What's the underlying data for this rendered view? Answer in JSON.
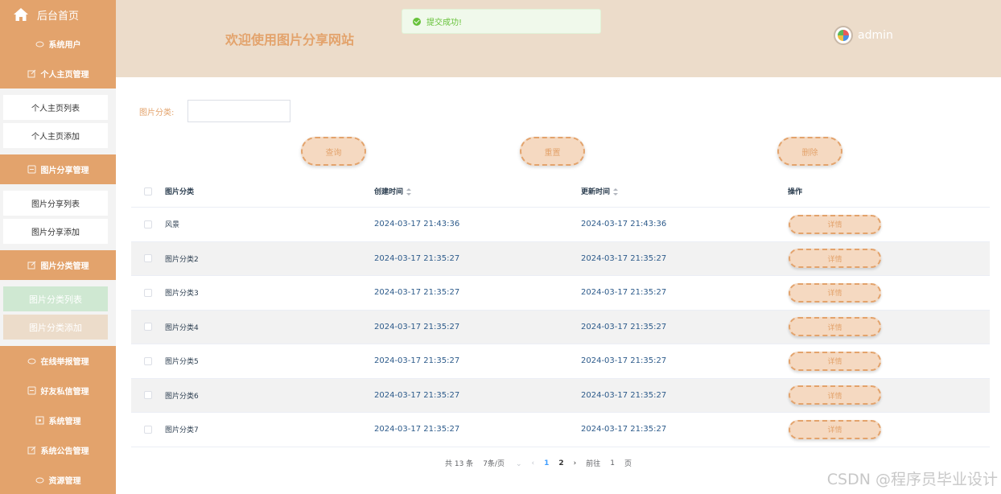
{
  "sidebar": {
    "home": "后台首页",
    "groups": [
      {
        "label": "系统用户"
      },
      {
        "label": "个人主页管理",
        "items": [
          "个人主页列表",
          "个人主页添加"
        ]
      },
      {
        "label": "图片分享管理",
        "items": [
          "图片分享列表",
          "图片分享添加"
        ]
      },
      {
        "label": "图片分类管理",
        "items": [
          "图片分类列表",
          "图片分类添加"
        ]
      },
      {
        "label": "在线举报管理"
      },
      {
        "label": "好友私信管理"
      },
      {
        "label": "系统管理"
      },
      {
        "label": "系统公告管理"
      },
      {
        "label": "资源管理"
      }
    ]
  },
  "header": {
    "title": "欢迎使用图片分享网站",
    "user": "admin"
  },
  "toast": {
    "message": "提交成功!"
  },
  "filter": {
    "label": "图片分类:",
    "value": ""
  },
  "buttons": {
    "search": "查询",
    "reset": "重置",
    "delete": "删除"
  },
  "table": {
    "columns": [
      "图片分类",
      "创建时间",
      "更新时间",
      "操作"
    ],
    "detail_label": "详情",
    "rows": [
      {
        "category": "风景",
        "created": "2024-03-17 21:43:36",
        "updated": "2024-03-17 21:43:36"
      },
      {
        "category": "图片分类2",
        "created": "2024-03-17 21:35:27",
        "updated": "2024-03-17 21:35:27"
      },
      {
        "category": "图片分类3",
        "created": "2024-03-17 21:35:27",
        "updated": "2024-03-17 21:35:27"
      },
      {
        "category": "图片分类4",
        "created": "2024-03-17 21:35:27",
        "updated": "2024-03-17 21:35:27"
      },
      {
        "category": "图片分类5",
        "created": "2024-03-17 21:35:27",
        "updated": "2024-03-17 21:35:27"
      },
      {
        "category": "图片分类6",
        "created": "2024-03-17 21:35:27",
        "updated": "2024-03-17 21:35:27"
      },
      {
        "category": "图片分类7",
        "created": "2024-03-17 21:35:27",
        "updated": "2024-03-17 21:35:27"
      }
    ]
  },
  "pagination": {
    "total": "共 13 条",
    "page_size": "7条/页",
    "pages": [
      "1",
      "2"
    ],
    "current": "1",
    "goto_prefix": "前往",
    "goto_value": "1",
    "goto_suffix": "页"
  },
  "watermark": "CSDN @程序员毕业设计",
  "colors": {
    "accent": "#e3a36c",
    "header_bg": "#ecdcca",
    "active_item": "#cfe8d2",
    "success": "#67c23a"
  }
}
